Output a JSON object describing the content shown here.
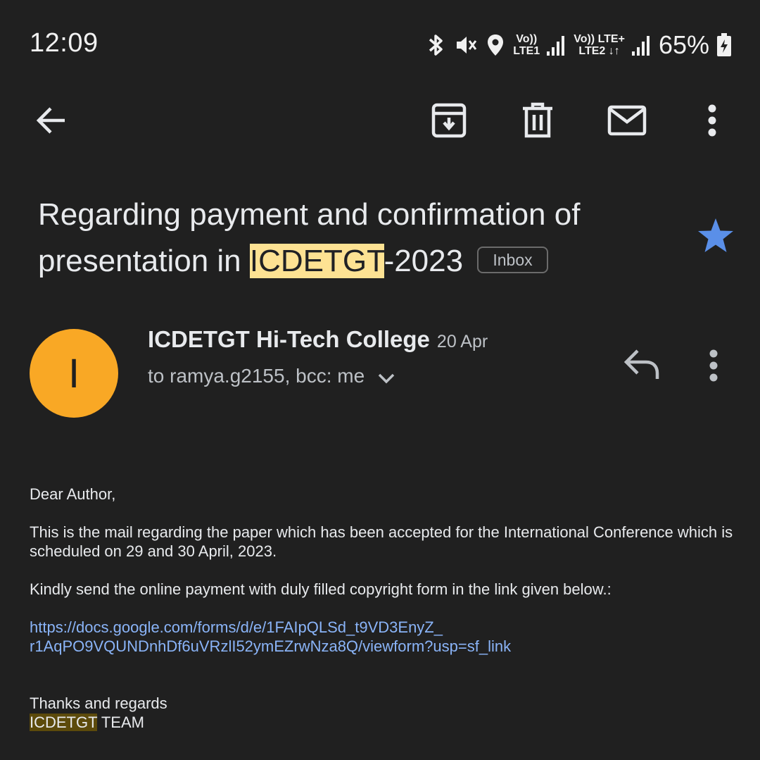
{
  "status_bar": {
    "time": "12:09",
    "sim1": {
      "volte": "Vo))",
      "network": "LTE1"
    },
    "sim2": {
      "volte": "Vo)) LTE+",
      "network": "LTE2 ↓↑"
    },
    "battery": "65%",
    "icons": [
      "bluetooth-icon",
      "vibrate-icon",
      "location-icon",
      "signal-icon",
      "battery-icon"
    ]
  },
  "toolbar": {
    "icons": [
      "back-arrow-icon",
      "archive-icon",
      "delete-icon",
      "mark-unread-icon",
      "more-vert-icon"
    ]
  },
  "subject": {
    "part1": "Regarding payment and confirmation of presentation in ",
    "highlight": "ICDETGT",
    "part2": "-2023",
    "label": "Inbox",
    "starred": true
  },
  "message": {
    "avatar_initial": "I",
    "sender": "ICDETGT Hi-Tech College",
    "date": "20 Apr",
    "recipients": "to ramya.g2155, bcc: me",
    "body": {
      "greeting": "Dear Author,",
      "para1": "This is the mail regarding the paper which has been accepted for the International Conference which is scheduled on 29 and 30 April, 2023.",
      "para2": "Kindly send the online payment with duly filled copyright form in the link given below.:",
      "link_line1": "https://docs.google.com/forms/d/e/1FAIpQLSd_t9VD3EnyZ_",
      "link_line2": "r1AqPO9VQUNDnhDf6uVRzlI52ymEZrwNza8Q/viewform?usp=sf_link",
      "closing": "Thanks and regards",
      "signature_highlight": "ICDETGT",
      "signature_rest": " TEAM"
    }
  },
  "colors": {
    "background": "#202020",
    "avatar": "#f9a825",
    "star": "#5a8fe8",
    "link": "#8ab4f8",
    "highlight": "#fde293"
  }
}
